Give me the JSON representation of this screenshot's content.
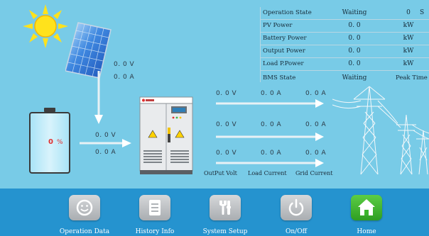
{
  "status_table": {
    "rows": [
      {
        "label": "Operation State",
        "value": "Waiting",
        "unit": "0",
        "extra": "S"
      },
      {
        "label": "PV Power",
        "value": "0. 0",
        "unit": "kW",
        "extra": ""
      },
      {
        "label": "Battery Power",
        "value": "0. 0",
        "unit": "kW",
        "extra": ""
      },
      {
        "label": "Output Power",
        "value": "0. 0",
        "unit": "kW",
        "extra": ""
      },
      {
        "label": "Load P.Power",
        "value": "0. 0",
        "unit": "kW",
        "extra": ""
      }
    ],
    "bms": {
      "label": "BMS State",
      "value": "Waiting",
      "extra": "Peak Time"
    }
  },
  "pv": {
    "voltage": "0. 0 V",
    "current": "0. 0 A"
  },
  "battery": {
    "soc_value": "0",
    "soc_unit": "%",
    "soc_level": 0,
    "voltage": "0. 0 V",
    "current": "0. 0 A"
  },
  "output_lines": [
    {
      "volt": "0. 0 V",
      "load": "0. 0 A",
      "grid": "0. 0 A"
    },
    {
      "volt": "0. 0 V",
      "load": "0. 0 A",
      "grid": "0. 0 A"
    },
    {
      "volt": "0. 0 V",
      "load": "0. 0 A",
      "grid": "0. 0 A"
    }
  ],
  "captions": {
    "output_volt": "OutPut Volt",
    "load_current": "Load Current",
    "grid_current": "Grid Current"
  },
  "nav": [
    {
      "label": "Operation Data",
      "icon": "face-icon"
    },
    {
      "label": "History Info",
      "icon": "document-icon"
    },
    {
      "label": "System Setup",
      "icon": "tools-icon"
    },
    {
      "label": "On/Off",
      "icon": "power-icon"
    },
    {
      "label": "Home",
      "icon": "home-icon"
    }
  ],
  "colors": {
    "background": "#78cbe7",
    "bottom_bar": "#2593cf",
    "soc_text": "#e03030",
    "home_button": "#3cb52c"
  }
}
